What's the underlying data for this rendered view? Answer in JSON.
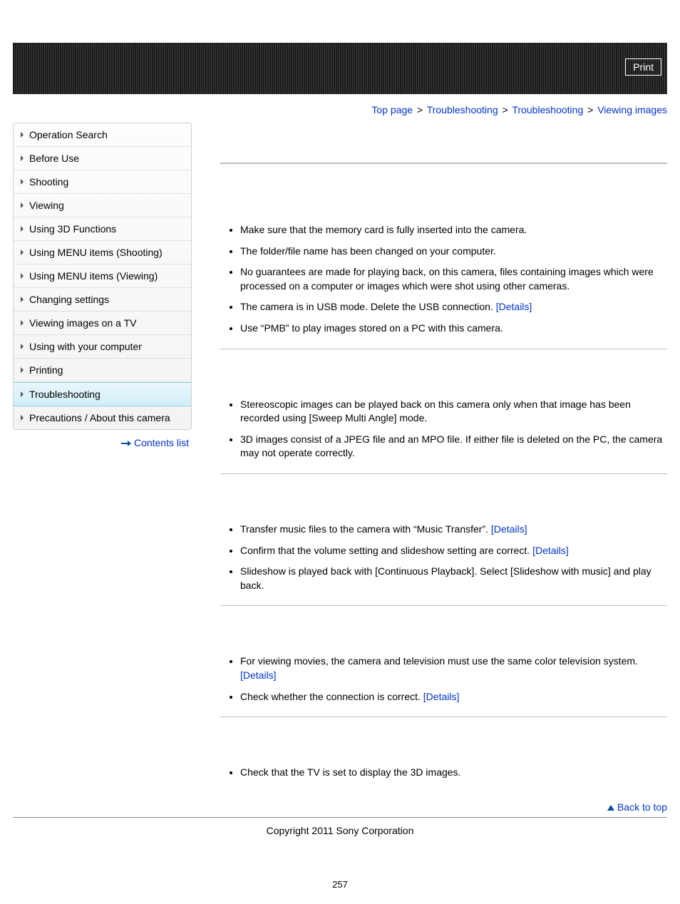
{
  "header": {
    "print_label": "Print"
  },
  "breadcrumb": {
    "items": [
      "Top page",
      "Troubleshooting",
      "Troubleshooting"
    ],
    "current": "Viewing images",
    "sep": ">"
  },
  "sidebar": {
    "items": [
      "Operation Search",
      "Before Use",
      "Shooting",
      "Viewing",
      "Using 3D Functions",
      "Using MENU items (Shooting)",
      "Using MENU items (Viewing)",
      "Changing settings",
      "Viewing images on a TV",
      "Using with your computer",
      "Printing",
      "Troubleshooting",
      "Precautions / About this camera"
    ],
    "active_index": 11,
    "contents_link": "Contents list"
  },
  "content": {
    "details_label": "[Details]",
    "sections": [
      {
        "items": [
          {
            "text": "Make sure that the memory card is fully inserted into the camera."
          },
          {
            "text": "The folder/file name has been changed on your computer."
          },
          {
            "text": "No guarantees are made for playing back, on this camera, files containing images which were processed on a computer or images which were shot using other cameras."
          },
          {
            "text": "The camera is in USB mode. Delete the USB connection. ",
            "details": true
          },
          {
            "text": "Use “PMB” to play images stored on a PC with this camera."
          }
        ]
      },
      {
        "items": [
          {
            "text": "Stereoscopic images can be played back on this camera only when that image has been recorded using [Sweep Multi Angle] mode."
          },
          {
            "text": "3D images consist of a JPEG file and an MPO file. If either file is deleted on the PC, the camera may not operate correctly."
          }
        ]
      },
      {
        "items": [
          {
            "text": "Transfer music files to the camera with “Music Transfer”. ",
            "details": true
          },
          {
            "text": "Confirm that the volume setting and slideshow setting are correct. ",
            "details": true
          },
          {
            "text": "Slideshow is played back with [Continuous Playback]. Select [Slideshow with music] and play back."
          }
        ]
      },
      {
        "items": [
          {
            "text": "For viewing movies, the camera and television must use the same color television system. ",
            "details": true,
            "details_newline": true
          },
          {
            "text": "Check whether the connection is correct. ",
            "details": true
          }
        ]
      },
      {
        "items": [
          {
            "text": "Check that the TV is set to display the 3D images."
          }
        ]
      }
    ]
  },
  "footer": {
    "back_to_top": "Back to top",
    "copyright": "Copyright 2011 Sony Corporation",
    "page_number": "257"
  }
}
